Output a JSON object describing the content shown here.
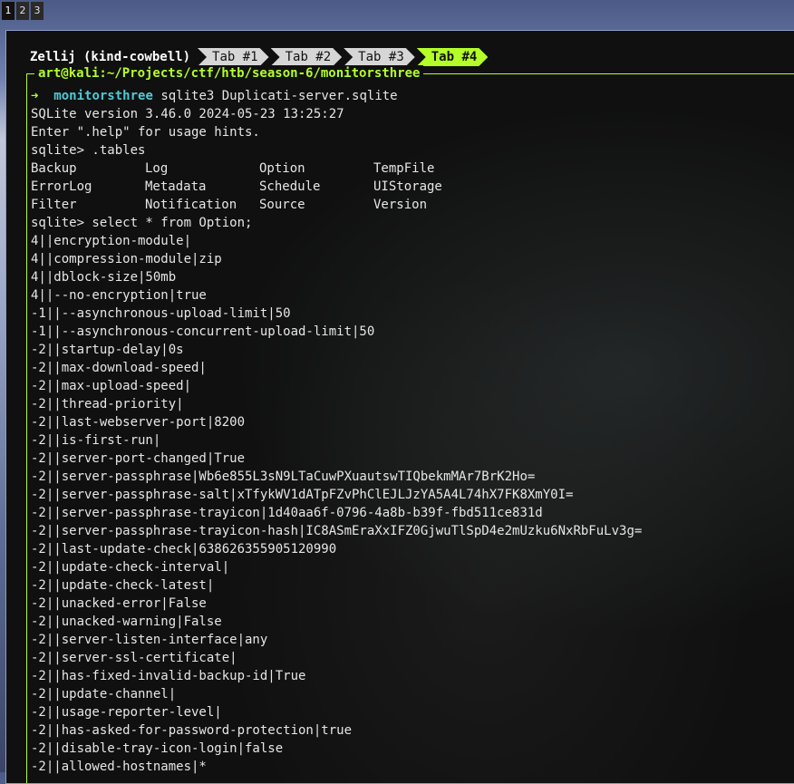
{
  "workspaces": [
    {
      "label": "1",
      "active": true
    },
    {
      "label": "2",
      "active": false
    },
    {
      "label": "3",
      "active": false
    }
  ],
  "zellij": {
    "session": "Zellij (kind-cowbell)",
    "tabs": [
      "Tab #1",
      "Tab #2",
      "Tab #3",
      "Tab #4"
    ],
    "active_tab": 3
  },
  "pane": {
    "title": "art@kali:~/Projects/ctf/htb/season-6/monitorsthree"
  },
  "terminal": {
    "prompt_arrow": "➜",
    "prompt_dir": "monitorsthree",
    "command": "sqlite3 Duplicati-server.sqlite",
    "lines_before_tables": [
      "SQLite version 3.46.0 2024-05-23 13:25:27",
      "Enter \".help\" for usage hints.",
      "sqlite> .tables"
    ],
    "tables": [
      [
        "Backup",
        "Log",
        "Option",
        "TempFile"
      ],
      [
        "ErrorLog",
        "Metadata",
        "Schedule",
        "UIStorage"
      ],
      [
        "Filter",
        "Notification",
        "Source",
        "Version"
      ]
    ],
    "lines_after_tables": [
      "sqlite> select * from Option;",
      "4||encryption-module|",
      "4||compression-module|zip",
      "4||dblock-size|50mb",
      "4||--no-encryption|true",
      "-1||--asynchronous-upload-limit|50",
      "-1||--asynchronous-concurrent-upload-limit|50",
      "-2||startup-delay|0s",
      "-2||max-download-speed|",
      "-2||max-upload-speed|",
      "-2||thread-priority|",
      "-2||last-webserver-port|8200",
      "-2||is-first-run|",
      "-2||server-port-changed|True",
      "-2||server-passphrase|Wb6e855L3sN9LTaCuwPXuautswTIQbekmMAr7BrK2Ho=",
      "-2||server-passphrase-salt|xTfykWV1dATpFZvPhClEJLJzYA5A4L74hX7FK8XmY0I=",
      "-2||server-passphrase-trayicon|1d40aa6f-0796-4a8b-b39f-fbd511ce831d",
      "-2||server-passphrase-trayicon-hash|IC8ASmEraXxIFZ0GjwuTlSpD4e2mUzku6NxRbFuLv3g=",
      "-2||last-update-check|638626355905120990",
      "-2||update-check-interval|",
      "-2||update-check-latest|",
      "-2||unacked-error|False",
      "-2||unacked-warning|False",
      "-2||server-listen-interface|any",
      "-2||server-ssl-certificate|",
      "-2||has-fixed-invalid-backup-id|True",
      "-2||update-channel|",
      "-2||usage-reporter-level|",
      "-2||has-asked-for-password-protection|true",
      "-2||disable-tray-icon-login|false",
      "-2||allowed-hostnames|*"
    ]
  }
}
